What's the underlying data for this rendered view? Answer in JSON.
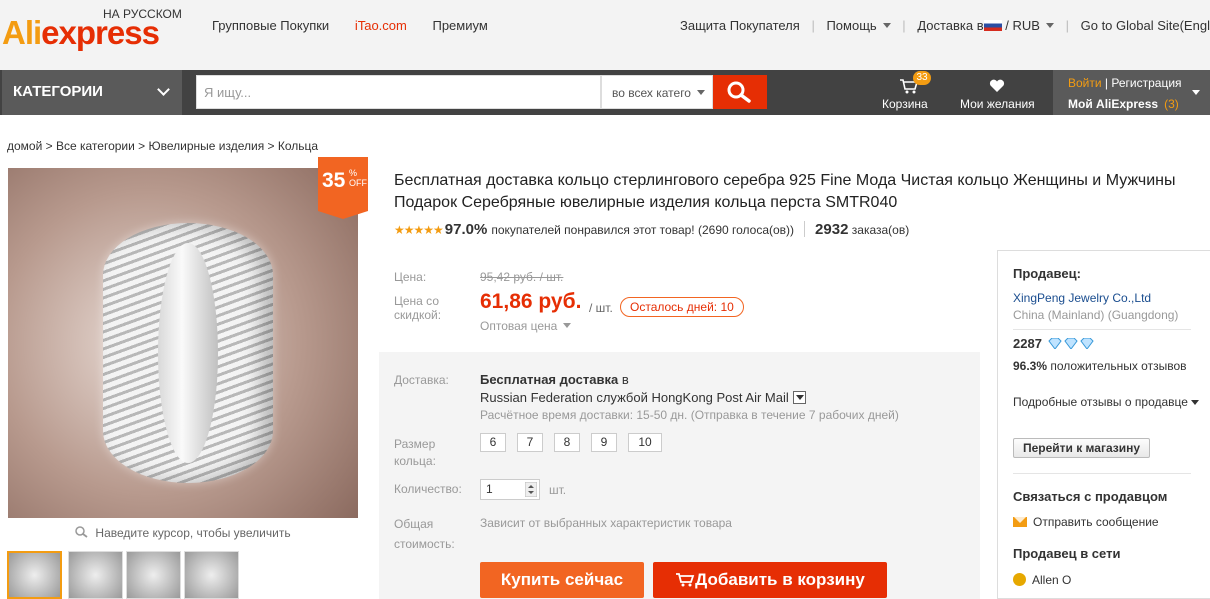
{
  "header": {
    "logo": "AliExpress",
    "language": "НА РУССКОМ",
    "links": [
      "Групповые Покупки",
      "iTao.com",
      "Премиум"
    ],
    "buyer_protection": "Защита Покупателя",
    "help": "Помощь",
    "ship_to": "Доставка в",
    "currency": "RUB",
    "global_site": "Go to Global Site(English)"
  },
  "nav": {
    "categories": "КАТЕГОРИИ",
    "search_placeholder": "Я ищу...",
    "search_scope": "во всех катего",
    "cart_label": "Корзина",
    "cart_count": "33",
    "wishlist_label": "Мои желания",
    "login": "Войти",
    "register": "Регистрация",
    "my_aliexpress": "Мой AliExpress",
    "my_count": "(3)"
  },
  "breadcrumb": "домой > Все категории > Ювелирные изделия > Кольца",
  "gallery": {
    "discount_percent": "35",
    "discount_suffix_top": "%",
    "discount_suffix_bottom": "OFF",
    "zoom_hint": "Наведите курсор, чтобы увеличить",
    "thumb_count": 4
  },
  "product": {
    "title": "Бесплатная доставка кольцо стерлингового серебра 925 Fine Мода Чистая кольцо Женщины и Мужчины Подарок Серебряные ювелирные изделия кольца перста SMTR040",
    "rating_pct": "97.0%",
    "rating_text": "покупателей понравился этот товар! (2690 голоса(ов))",
    "orders_count": "2932",
    "orders_label": "заказа(ов)",
    "price_label": "Цена:",
    "old_price": "95,42 руб. / шт.",
    "discount_label": "Цена со скидкой:",
    "price": "61,86 руб.",
    "price_unit": "/ шт.",
    "days_left": "Осталось дней: 10",
    "wholesale": "Оптовая цена",
    "shipping_label": "Доставка:",
    "shipping_free": "Бесплатная доставка",
    "shipping_in": "в",
    "shipping_method": "Russian Federation службой HongKong Post Air Mail",
    "shipping_time": "Расчётное время доставки: 15-50 дн. (Отправка в течение 7 рабочих дней)",
    "size_label": "Размер кольца:",
    "sizes": [
      "6",
      "7",
      "8",
      "9",
      "10"
    ],
    "qty_label": "Количество:",
    "qty_value": "1",
    "qty_unit": "шт.",
    "total_label": "Общая стоимость:",
    "total_value": "Зависит от выбранных характеристик товара",
    "buy_now": "Купить сейчас",
    "add_to_cart": "Добавить в корзину"
  },
  "seller": {
    "heading": "Продавец:",
    "name": "XingPeng Jewelry Co.,Ltd",
    "location": "China (Mainland) (Guangdong)",
    "score": "2287",
    "positive_pct": "96.3%",
    "positive_text": "положительных отзывов",
    "detailed": "Подробные отзывы о продавце",
    "go_store": "Перейти к магазину",
    "contact_heading": "Связаться с продавцом",
    "send_message": "Отправить сообщение",
    "online_heading": "Продавец в сети",
    "online_name": "Allen O"
  },
  "colors": {
    "brand": "#e62e04",
    "orange": "#f26522",
    "nav_bg": "#424242"
  }
}
